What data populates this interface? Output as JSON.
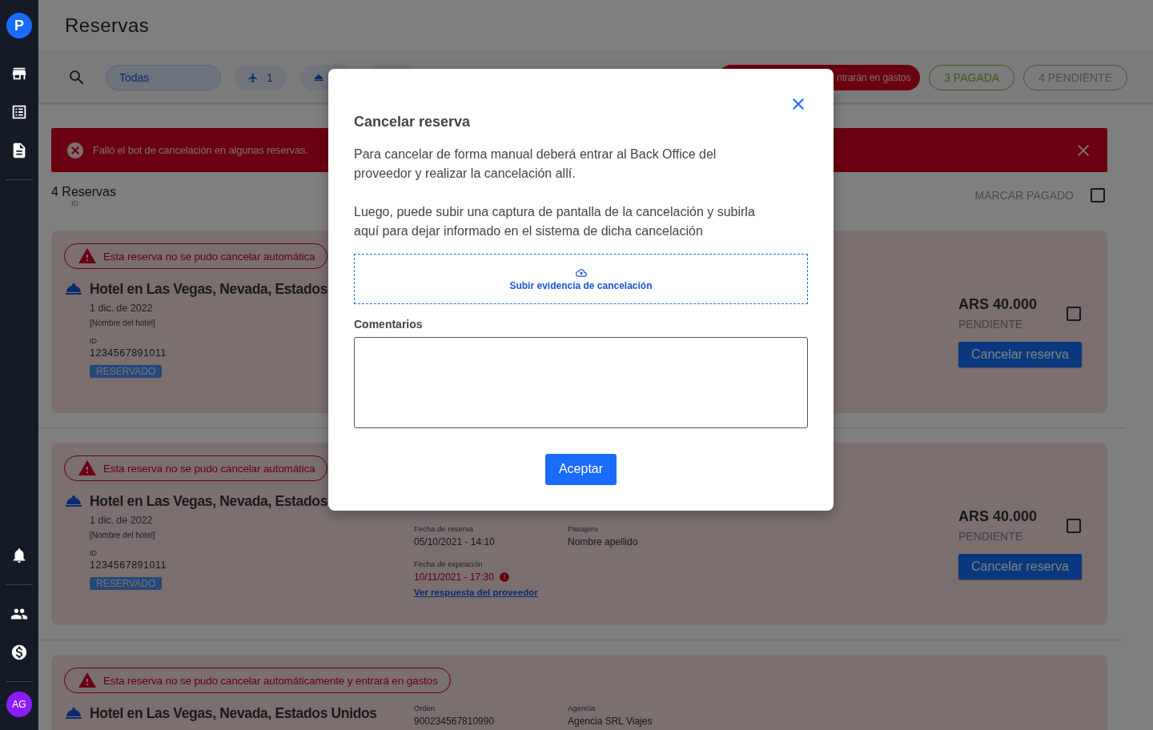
{
  "sidebar": {
    "logo": "P",
    "nav": [
      {
        "kind": "store"
      },
      {
        "kind": "list"
      },
      {
        "kind": "document"
      }
    ],
    "bottom": [
      {
        "kind": "bell"
      },
      {
        "kind": "people"
      },
      {
        "kind": "dollar"
      }
    ],
    "avatar": "AG"
  },
  "header": {
    "title": "Reservas"
  },
  "filters": {
    "chips": [
      {
        "kind": "text",
        "label": "Todas",
        "selected": true
      },
      {
        "kind": "flight",
        "label": "1",
        "selected": false
      },
      {
        "kind": "hotel",
        "selected": false
      },
      {
        "kind": "blank",
        "selected": false
      }
    ],
    "alert_chip": "ntrarán en gastos",
    "status_chips": [
      {
        "label": "3 PAGADA",
        "kind": "paid"
      },
      {
        "label": "4 PENDIENTE",
        "kind": "pending"
      }
    ]
  },
  "banner": {
    "text": "Falló el bot de cancelación en algunas reservas."
  },
  "summary": {
    "count": "4 Reservas",
    "id_label": "ID",
    "mark_paid": "MARCAR PAGADO",
    "checked": false
  },
  "cards": [
    {
      "warning": "Esta reserva no se pudo cancelar automática",
      "title": "Hotel en Las Vegas, Nevada, Estados",
      "date": "1 dic. de 2022",
      "hotel_name": "[Nombre del hotel]",
      "id_label": "ID",
      "id": "1234567891011",
      "badge": "RESERVADO",
      "price": "ARS 40.000",
      "payment": "PENDIENTE",
      "checked": false,
      "button": "Cancelar reserva"
    },
    {
      "warning": "Esta reserva no se pudo cancelar automática",
      "title": "Hotel en Las Vegas, Nevada, Estados",
      "date": "1 dic. de 2022",
      "hotel_name": "[Nombre del hotel]",
      "id_label": "ID",
      "id": "1234567891011",
      "badge": "RESERVADO",
      "details": [
        [
          {
            "kind": "plain",
            "label": "Fecha de reserva",
            "value": "05/10/2021 - 14:10"
          },
          {
            "kind": "error",
            "label": "Fecha de expiración",
            "value": "10/11/2021 - 17:30"
          },
          {
            "kind": "link",
            "value": "Ver respuesta del proveedor"
          }
        ],
        [
          {
            "kind": "plain",
            "label": "Pasajero",
            "value": "Nombre apellido"
          }
        ]
      ],
      "price": "ARS 40.000",
      "payment": "PENDIENTE",
      "checked": false,
      "button": "Cancelar reserva"
    },
    {
      "warning": "Esta reserva no se pudo cancelar automáticamente y entrará en gastos",
      "title": "Hotel en Las Vegas, Nevada, Estados Unidos",
      "details": [
        [
          {
            "kind": "plain",
            "label": "Orden",
            "value": "900234567810990"
          }
        ],
        [
          {
            "kind": "plain",
            "label": "Agencia",
            "value": "Agencia SRL Viajes"
          }
        ]
      ]
    }
  ],
  "modal": {
    "title": "Cancelar reserva",
    "paragraphs": [
      "Para cancelar de forma manual deberá entrar al Back Office del proveedor y realizar la cancelación allí.",
      "Luego, puede subir una captura de pantalla de la cancelación y subirla aquí para dejar informado en el sistema de dicha cancelación"
    ],
    "upload": "Subir evidencia de cancelación",
    "comments_label": "Comentarios",
    "button": "Aceptar"
  }
}
